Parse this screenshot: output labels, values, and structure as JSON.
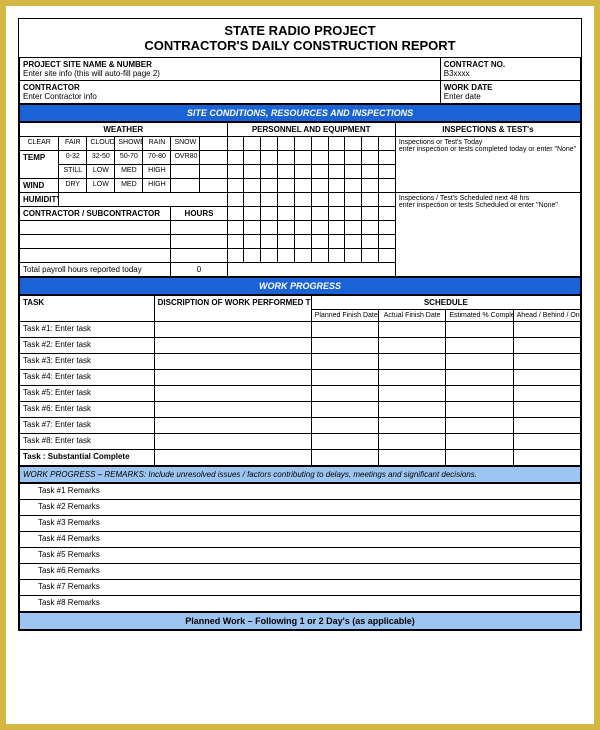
{
  "header": {
    "title1": "STATE RADIO PROJECT",
    "title2": "CONTRACTOR'S DAILY CONSTRUCTION REPORT"
  },
  "top": {
    "site_label": "PROJECT SITE NAME & NUMBER",
    "site_value": "Enter site info (this will auto-fill page 2)",
    "contractor_label": "CONTRACTOR",
    "contractor_value": "Enter Contractor info",
    "contract_label": "CONTRACT NO.",
    "contract_value": "B3xxxx",
    "date_label": "WORK DATE",
    "date_value": "Enter date"
  },
  "section1_title": "SITE CONDITIONS, RESOURCES AND INSPECTIONS",
  "weather": {
    "header": "WEATHER",
    "cols": [
      "CLEAR",
      "FAIR",
      "CLOUDY",
      "SHOWER",
      "RAIN",
      "SNOW"
    ],
    "rows": {
      "temp_label": "TEMP",
      "temp_vals": [
        "0-32",
        "32-50",
        "50-70",
        "70-80",
        "OVR80"
      ],
      "wind_label": "WIND",
      "wind_vals": [
        "STILL",
        "LOW",
        "MED",
        "HIGH"
      ],
      "humid_label": "HUMIDITY",
      "humid_vals": [
        "DRY",
        "LOW",
        "MED",
        "HIGH"
      ]
    }
  },
  "personnel_header": "PERSONNEL AND EQUIPMENT",
  "inspections": {
    "header": "INSPECTIONS & TEST's",
    "today_label": "Inspections or Test's Today",
    "today_value": "enter inspection or tests completed today or enter \"None\"",
    "next_label": "Inspections / Test's Scheduled next 48 hrs",
    "next_value": "enter inspection or tests Scheduled or enter \"None\""
  },
  "contractor_sub_label": "CONTRACTOR / SUBCONTRACTOR",
  "hours_label": "HOURS",
  "payroll_label": "Total payroll hours reported today",
  "payroll_value": "0",
  "section2_title": "WORK PROGRESS",
  "progress": {
    "task_header": "TASK",
    "desc_header": "DISCRIPTION OF WORK PERFORMED This Report",
    "schedule_header": "SCHEDULE",
    "cols": [
      "Planned Finish Date",
      "Actual Finish Date",
      "Estimated % Complete",
      "Ahead / Behind / On Schedule"
    ],
    "tasks": [
      "Task #1: Enter task",
      "Task #2: Enter task",
      "Task #3: Enter task",
      "Task #4: Enter task",
      "Task #5: Enter task",
      "Task #6: Enter task",
      "Task #7: Enter task",
      "Task #8: Enter task"
    ],
    "substantial": "Task : Substantial Complete"
  },
  "remarks": {
    "header": "WORK PROGRESS – REMARKS:  Include unresolved issues / factors contributing to delays, meetings and significant decisions.",
    "items": [
      "Task #1 Remarks",
      "Task #2 Remarks",
      "Task #3 Remarks",
      "Task #4 Remarks",
      "Task #5 Remarks",
      "Task #6 Remarks",
      "Task #7 Remarks",
      "Task #8 Remarks"
    ]
  },
  "planned_footer": "Planned Work – Following 1 or 2 Day's (as applicable)"
}
